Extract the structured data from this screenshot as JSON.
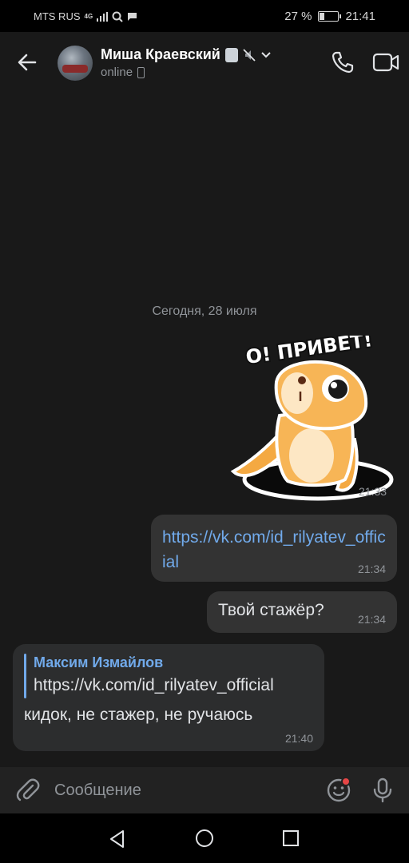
{
  "status_bar": {
    "carrier": "MTS RUS",
    "network": "4G",
    "battery": "27 %",
    "time": "21:41"
  },
  "header": {
    "contact_name": "Миша Краевский",
    "status": "online"
  },
  "chat": {
    "date_separator": "Сегодня, 28 июля",
    "sticker": {
      "text": "О! ПРИВЕТ!",
      "time": "21:33"
    },
    "messages": [
      {
        "direction": "out",
        "text": "https://vk.com/id_rilyatev_official",
        "time": "21:34"
      },
      {
        "direction": "out",
        "text": "Твой стажёр?",
        "time": "21:34"
      },
      {
        "direction": "in",
        "reply_author": "Максим Измайлов",
        "reply_text": "https://vk.com/id_rilyatev_official",
        "text": "кидок, не стажер, не ручаюсь",
        "time": "21:40"
      }
    ]
  },
  "composer": {
    "placeholder": "Сообщение"
  },
  "colors": {
    "accent": "#71aaeb",
    "background": "#191919",
    "bubble": "#333333",
    "notification_dot": "#e64646"
  }
}
